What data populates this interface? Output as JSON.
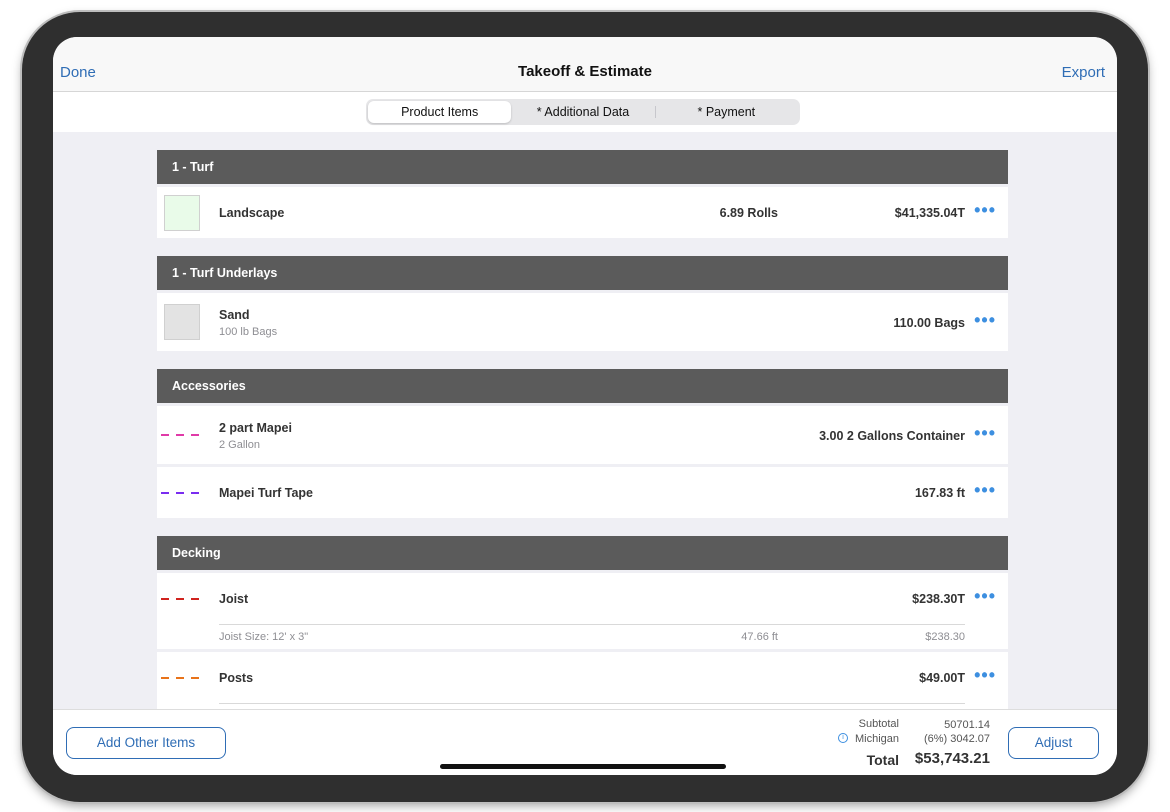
{
  "nav": {
    "done_label": "Done",
    "title": "Takeoff & Estimate",
    "export_label": "Export"
  },
  "tabs": [
    {
      "label": "Product Items",
      "active": true
    },
    {
      "label": "* Additional Data",
      "active": false
    },
    {
      "label": "* Payment",
      "active": false
    }
  ],
  "sections": [
    {
      "title": "1 - Turf",
      "items": [
        {
          "name": "Landscape",
          "quantity": "6.89 Rolls",
          "price": "$41,335.04T",
          "swatch": "#e9fbe9",
          "icon": "swatch"
        }
      ]
    },
    {
      "title": "1 - Turf Underlays",
      "items": [
        {
          "name": "Sand",
          "sub": "100 lb Bags",
          "quantity": "110.00 Bags",
          "swatch": "#e3e3e3",
          "icon": "swatch"
        }
      ]
    },
    {
      "title": "Accessories",
      "items": [
        {
          "name": "2 part Mapei",
          "sub": "2 Gallon",
          "quantity": "3.00 2 Gallons Container",
          "line_color": "#e03aa8",
          "icon": "dashed-line"
        },
        {
          "name": "Mapei Turf Tape",
          "quantity": "167.83 ft",
          "line_color": "#7a2cf0",
          "icon": "dashed-line"
        }
      ]
    },
    {
      "title": "Decking",
      "items": [
        {
          "name": "Joist",
          "price": "$238.30T",
          "line_color": "#d0231e",
          "icon": "dashed-line",
          "detail": {
            "label": "Joist Size: 12' x 3\"",
            "quantity": "47.66 ft",
            "price": "$238.30"
          }
        },
        {
          "name": "Posts",
          "price": "$49.00T",
          "line_color": "#e8731a",
          "icon": "dashed-line"
        }
      ]
    }
  ],
  "more_glyph": "•••",
  "footer": {
    "add_label": "Add Other Items",
    "adjust_label": "Adjust",
    "subtotal_label": "Subtotal",
    "subtotal_value": "50701.14",
    "tax_label": "Michigan",
    "tax_value": "(6%) 3042.07",
    "total_label": "Total",
    "total_value": "$53,743.21"
  },
  "colors": {
    "accent": "#2f6db5",
    "more_dots": "#3d8fe0",
    "section_header": "#5b5b5b"
  }
}
